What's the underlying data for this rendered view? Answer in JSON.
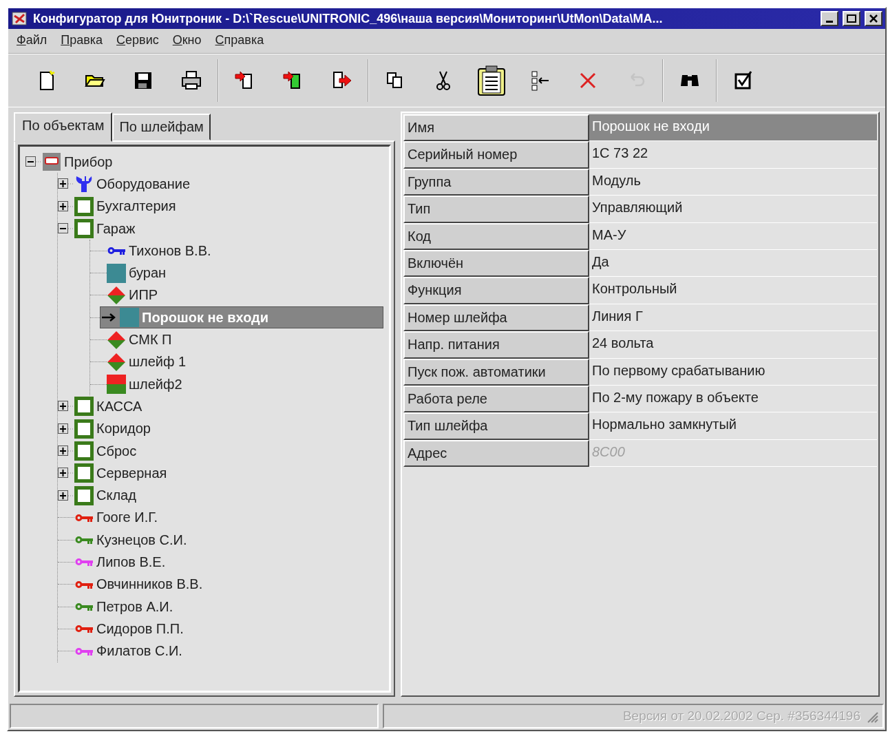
{
  "window": {
    "title": "Конфигуратор для Юнитроник - D:\\`Rescue\\UNITRONIC_496\\наша версия\\Мониторинг\\UtMon\\Data\\MA..."
  },
  "menu": [
    "Файл",
    "Правка",
    "Сервис",
    "Окно",
    "Справка"
  ],
  "toolbar": [
    [
      {
        "disabled": false
      },
      {
        "disabled": false
      },
      {
        "disabled": false
      },
      {
        "disabled": false
      }
    ],
    [
      {
        "disabled": false
      },
      {
        "disabled": false
      },
      {
        "disabled": false
      }
    ],
    [
      {
        "disabled": false
      },
      {
        "disabled": false
      },
      {
        "disabled": false
      },
      {
        "disabled": false
      },
      {
        "disabled": false
      },
      {
        "disabled": true
      }
    ],
    [
      {
        "disabled": false
      }
    ],
    [
      {
        "disabled": false
      }
    ]
  ],
  "tabs": [
    {
      "label": "По объектам",
      "selected": true
    },
    {
      "label": "По шлейфам",
      "selected": false
    }
  ],
  "tree": [
    {
      "label": "Прибор",
      "kind": "device",
      "expanded": true,
      "selected": false,
      "children": [
        {
          "label": "Оборудование",
          "kind": "tools",
          "expanded": false,
          "selected": false
        },
        {
          "label": "Бухгалтерия",
          "kind": "zone",
          "expanded": false,
          "selected": false
        },
        {
          "label": "Гараж",
          "kind": "zone",
          "expanded": true,
          "selected": false,
          "children": [
            {
              "label": "Тихонов В.В.",
              "kind": "key",
              "color": "#2020e0",
              "selected": false
            },
            {
              "label": "буран",
              "kind": "square",
              "selected": false
            },
            {
              "label": "ИПР",
              "kind": "diamond",
              "selected": false
            },
            {
              "label": "Порошок не входи",
              "kind": "square",
              "selected": true
            },
            {
              "label": "СМК П",
              "kind": "diamond",
              "selected": false
            },
            {
              "label": "шлейф 1",
              "kind": "diamond",
              "selected": false
            },
            {
              "label": "шлейф2",
              "kind": "split",
              "selected": false
            }
          ]
        },
        {
          "label": "КАССА",
          "kind": "zone",
          "expanded": false,
          "selected": false
        },
        {
          "label": "Коридор",
          "kind": "zone",
          "expanded": false,
          "selected": false
        },
        {
          "label": "Сброс",
          "kind": "zone",
          "expanded": false,
          "selected": false
        },
        {
          "label": "Серверная",
          "kind": "zone",
          "expanded": false,
          "selected": false
        },
        {
          "label": "Склад",
          "kind": "zone",
          "expanded": false,
          "selected": false
        },
        {
          "label": "Гооге И.Г.",
          "kind": "key",
          "color": "#e02010",
          "selected": false
        },
        {
          "label": "Кузнецов С.И.",
          "kind": "key",
          "color": "#3a8a20",
          "selected": false
        },
        {
          "label": "Липов В.Е.",
          "kind": "key",
          "color": "#e040f0",
          "selected": false
        },
        {
          "label": "Овчинников В.В.",
          "kind": "key",
          "color": "#e02010",
          "selected": false
        },
        {
          "label": "Петров А.И.",
          "kind": "key",
          "color": "#3a8a20",
          "selected": false
        },
        {
          "label": "Сидоров П.П.",
          "kind": "key",
          "color": "#e02010",
          "selected": false
        },
        {
          "label": "Филатов С.И.",
          "kind": "key",
          "color": "#e040f0",
          "selected": false
        }
      ]
    }
  ],
  "properties": [
    {
      "name": "Имя",
      "value": "Порошок не входи",
      "selected": true,
      "disabled": false
    },
    {
      "name": "Серийный номер",
      "value": "1C 73 22",
      "selected": false,
      "disabled": false
    },
    {
      "name": "Группа",
      "value": "Модуль",
      "selected": false,
      "disabled": false
    },
    {
      "name": "Тип",
      "value": "Управляющий",
      "selected": false,
      "disabled": false
    },
    {
      "name": "Код",
      "value": "МА-У",
      "selected": false,
      "disabled": false
    },
    {
      "name": "Включён",
      "value": "Да",
      "selected": false,
      "disabled": false
    },
    {
      "name": "Функция",
      "value": "Контрольный",
      "selected": false,
      "disabled": false
    },
    {
      "name": "Номер шлейфа",
      "value": "Линия Г",
      "selected": false,
      "disabled": false
    },
    {
      "name": "Напр. питания",
      "value": "24 вольта",
      "selected": false,
      "disabled": false
    },
    {
      "name": "Пуск пож. автоматики",
      "value": "По первому срабатыванию",
      "selected": false,
      "disabled": false
    },
    {
      "name": "Работа реле",
      "value": "По 2-му пожару в объекте",
      "selected": false,
      "disabled": false
    },
    {
      "name": "Тип шлейфа",
      "value": "Нормально замкнутый",
      "selected": false,
      "disabled": false
    },
    {
      "name": "Адрес",
      "value": "8C00",
      "selected": false,
      "disabled": true
    }
  ],
  "status_bar": {
    "text": "Версия от 20.02.2002  Сер. #356344196"
  }
}
